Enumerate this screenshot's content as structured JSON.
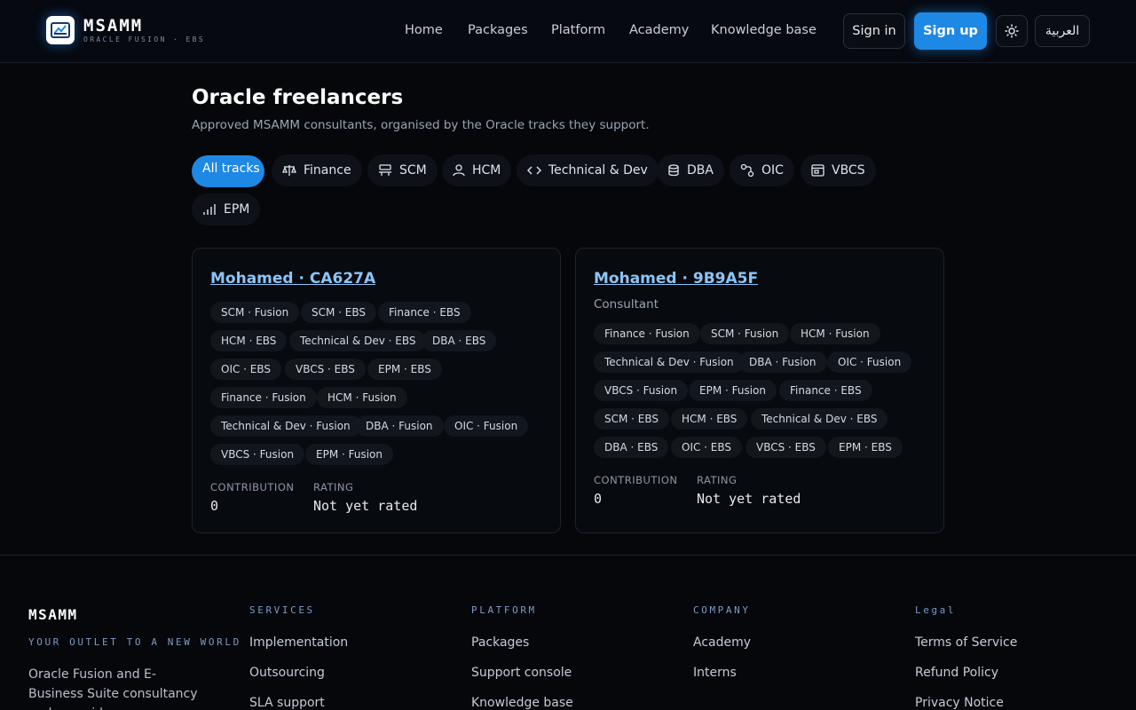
{
  "header": {
    "brand_name": "MSAMM",
    "brand_sub": "ORACLE FUSION · EBS",
    "nav": [
      "Home",
      "Packages",
      "Platform",
      "Academy",
      "Knowledge base"
    ],
    "sign_in": "Sign in",
    "sign_up": "Sign up",
    "language": "العربية"
  },
  "main": {
    "title": "Oracle freelancers",
    "subtitle": "Approved MSAMM consultants, organised by the Oracle tracks they support.",
    "filters": [
      "All tracks",
      "Finance",
      "SCM",
      "HCM",
      "Technical & Dev",
      "DBA",
      "OIC",
      "VBCS",
      "EPM"
    ]
  },
  "cards": [
    {
      "name": "Mohamed · CA627A",
      "role": "",
      "tags": [
        "SCM · Fusion",
        "SCM · EBS",
        "Finance · EBS",
        "HCM · EBS",
        "Technical & Dev · EBS",
        "DBA · EBS",
        "OIC · EBS",
        "VBCS · EBS",
        "EPM · EBS",
        "Finance · Fusion",
        "HCM · Fusion",
        "Technical & Dev · Fusion",
        "DBA · Fusion",
        "OIC · Fusion",
        "VBCS · Fusion",
        "EPM · Fusion"
      ],
      "contribution_label": "CONTRIBUTION",
      "contribution": "0",
      "rating_label": "RATING",
      "rating": "Not yet rated"
    },
    {
      "name": "Mohamed · 9B9A5F",
      "role": "Consultant",
      "tags": [
        "Finance · Fusion",
        "SCM · Fusion",
        "HCM · Fusion",
        "Technical & Dev · Fusion",
        "DBA · Fusion",
        "OIC · Fusion",
        "VBCS · Fusion",
        "EPM · Fusion",
        "Finance · EBS",
        "SCM · EBS",
        "HCM · EBS",
        "Technical & Dev · EBS",
        "DBA · EBS",
        "OIC · EBS",
        "VBCS · EBS",
        "EPM · EBS"
      ],
      "contribution_label": "CONTRIBUTION",
      "contribution": "0",
      "rating_label": "RATING",
      "rating": "Not yet rated"
    }
  ],
  "footer": {
    "brand": "MSAMM",
    "tagline": "YOUR OUTLET TO A NEW WORLD",
    "description": "Oracle Fusion and E-Business Suite consultancy and prepaid",
    "columns": [
      {
        "heading": "SERVICES",
        "links": [
          "Implementation",
          "Outsourcing",
          "SLA support"
        ]
      },
      {
        "heading": "PLATFORM",
        "links": [
          "Packages",
          "Support console",
          "Knowledge base"
        ]
      },
      {
        "heading": "COMPANY",
        "links": [
          "Academy",
          "Interns"
        ]
      },
      {
        "heading": "Legal",
        "links": [
          "Terms of Service",
          "Refund Policy",
          "Privacy Notice"
        ]
      }
    ]
  }
}
